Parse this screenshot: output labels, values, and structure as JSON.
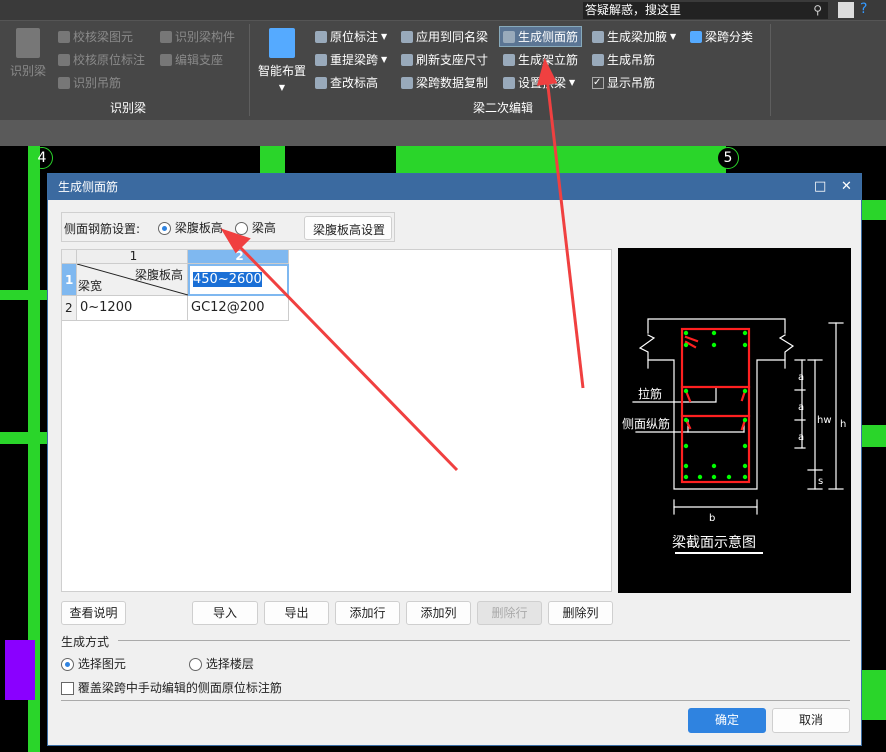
{
  "topbar": {
    "search_placeholder": "答疑解惑，搜这里",
    "search_icon": "search-icon"
  },
  "ribbon": {
    "group1": {
      "label": "识别梁",
      "items": [
        "识别梁",
        "校核梁图元",
        "校核原位标注",
        "识别吊筋",
        "识别梁构件",
        "编辑支座"
      ]
    },
    "group2": {
      "label": "梁二次编辑",
      "big": "智能布置",
      "items": [
        "原位标注",
        "重提梁跨",
        "查改标高",
        "应用到同名梁",
        "刷新支座尺寸",
        "梁跨数据复制",
        "生成侧面筋",
        "生成架立筋",
        "设置拱梁",
        "生成梁加腋",
        "生成吊筋",
        "显示吊筋",
        "梁跨分类"
      ]
    }
  },
  "cad": {
    "axis_4": "4",
    "axis_5": "5"
  },
  "dialog": {
    "title": "生成侧面筋",
    "setting_label": "侧面钢筋设置:",
    "radio_web": "梁腹板高",
    "radio_height": "梁高",
    "web_setting_btn": "梁腹板高设置",
    "selected_setting": "梁腹板高",
    "table": {
      "col_headers": [
        "1",
        "2"
      ],
      "row_headers": [
        "1",
        "2"
      ],
      "header_cell_top": "梁腹板高",
      "header_cell_bottom": "梁宽",
      "rows": [
        [
          "",
          "450~2600"
        ],
        [
          "0~1200",
          "GC12@200"
        ]
      ]
    },
    "diagram": {
      "title": "梁截面示意图",
      "label_tie": "拉筋",
      "label_side": "侧面纵筋",
      "dim_a": "a",
      "dim_hw": "hw",
      "dim_h": "h",
      "dim_s": "s",
      "dim_b": "b",
      "colors": {
        "stirrup": "#ff2020",
        "bar": "#00ff00",
        "line": "#ffffff"
      }
    },
    "buttons": {
      "help": "查看说明",
      "import": "导入",
      "export": "导出",
      "add_row": "添加行",
      "add_col": "添加列",
      "del_row": "删除行",
      "del_col": "删除列",
      "ok": "确定",
      "cancel": "取消"
    },
    "gen_mode": {
      "label": "生成方式",
      "opt1": "选择图元",
      "opt2": "选择楼层",
      "selected": "选择图元"
    },
    "overwrite_label": "覆盖梁跨中手动编辑的侧面原位标注筋",
    "overwrite_checked": false
  },
  "colors": {
    "accent": "#2f83e0",
    "title_bar": "#3b6aa0",
    "cad_green": "#2ad52a",
    "annotation_arrow": "#f04040"
  }
}
